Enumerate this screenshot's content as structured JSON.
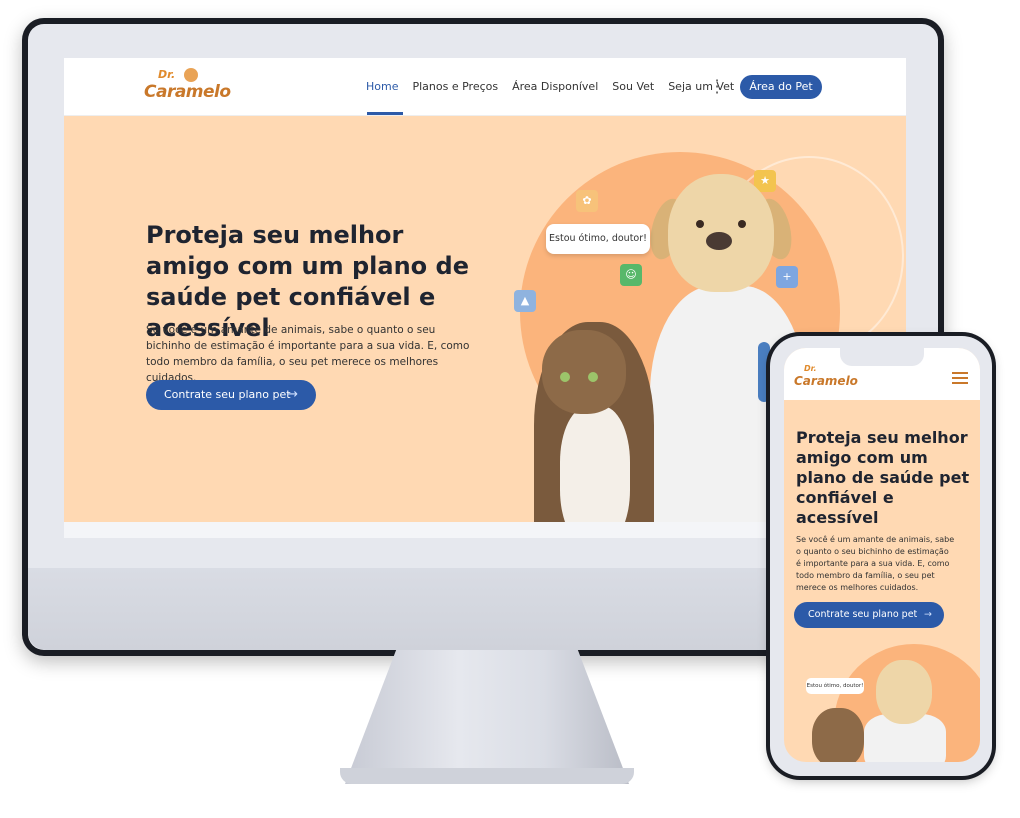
{
  "desktop": {
    "logo": {
      "prefix": "Dr.",
      "name": "Caramelo"
    },
    "nav": {
      "items": [
        "Home",
        "Planos e Preços",
        "Área Disponível",
        "Sou Vet",
        "Seja um Vet"
      ],
      "active": "Home",
      "more_icon": "kebab-menu-icon",
      "cta_label": "Área do Pet"
    },
    "hero": {
      "title": "Proteja seu melhor amigo com um plano de saúde pet confiável e acessível",
      "description": "Se você é um amante de animais, sabe o quanto o seu bichinho de estimação é importante para a sua vida. E, como todo membro da família, o seu pet merece os melhores cuidados.",
      "cta_label": "Contrate seu plano pet",
      "cta_icon": "arrow-right-icon",
      "speech_bubble": "Estou ótimo, doutor!"
    }
  },
  "mobile": {
    "logo": {
      "prefix": "Dr.",
      "name": "Caramelo"
    },
    "menu_icon": "hamburger-menu-icon",
    "hero": {
      "title": "Proteja seu melhor amigo com um plano de saúde pet confiável e acessível",
      "description": "Se você é um amante de animais, sabe o quanto o seu bichinho de estimação é importante para a sua vida. E, como todo membro da família, o seu pet merece os melhores cuidados.",
      "cta_label": "Contrate seu plano pet",
      "speech_bubble": "Estou ótimo, doutor!"
    }
  },
  "colors": {
    "brand_blue": "#2c5aa8",
    "hero_bg": "#ffd9b3",
    "accent_orange": "#fbb47c",
    "logo_brown": "#c9782a"
  }
}
